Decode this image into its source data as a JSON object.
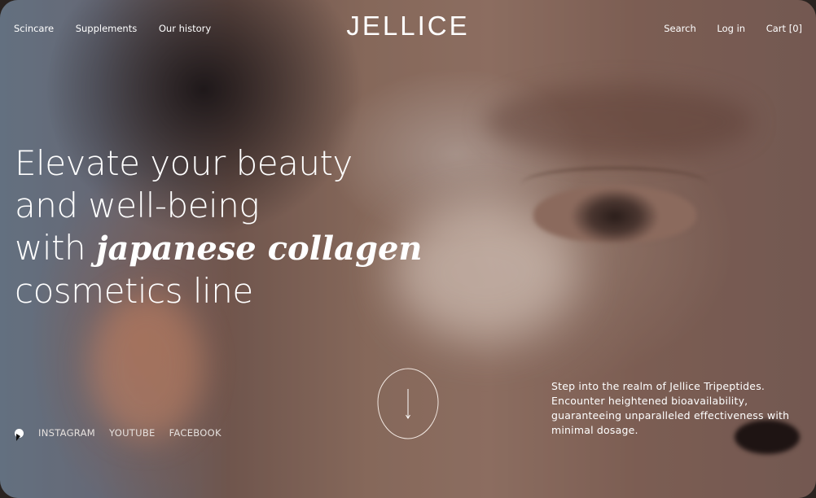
{
  "nav": {
    "left": [
      "Scincare",
      "Supplements",
      "Our history"
    ],
    "search": "Search",
    "login": "Log in",
    "cart": "Cart [0]"
  },
  "brand": {
    "logo": "JELLICE"
  },
  "hero": {
    "line1": "Elevate your beauty",
    "line2": "and well-being",
    "line3_prefix": "with ",
    "line3_emphasis": "japanese collagen",
    "line4": "cosmetics line"
  },
  "social": {
    "links": [
      "INSTAGRAM",
      "YOUTUBE",
      "FACEBOOK"
    ]
  },
  "scroll": {
    "icon": "arrow-down-icon"
  },
  "blurb": {
    "text": "Step into the realm of Jellice Tripeptides. Encounter heightened bioavailability, guaranteeing unparalleled effectiveness with minimal dosage."
  },
  "colors": {
    "text": "#ffffff",
    "social_text": "#e6e1de"
  }
}
